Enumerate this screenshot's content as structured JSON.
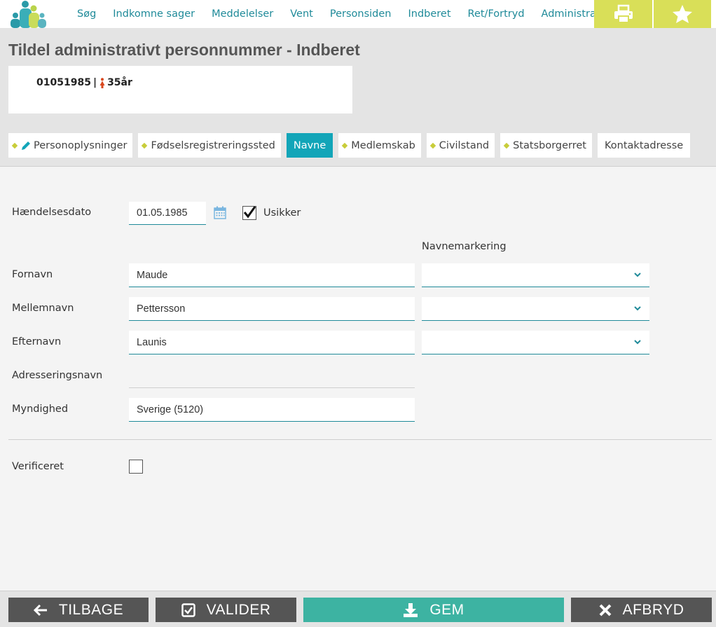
{
  "nav": {
    "items": [
      "Søg",
      "Indkomne sager",
      "Meddelelser",
      "Vent",
      "Personsiden",
      "Indberet",
      "Ret/Fortryd",
      "Administration"
    ],
    "print_icon": "printer-icon",
    "star_icon": "star-icon"
  },
  "colors": {
    "accent": "#1f8a99",
    "tab_active": "#12a5b8",
    "yellow": "#d9df58",
    "save": "#3db3a2",
    "dark_button": "#555555"
  },
  "page": {
    "title": "Tildel administrativt personnummer - Indberet"
  },
  "person": {
    "cpr": "01051985",
    "separator": "|",
    "age": "35år",
    "gender_icon": "female-icon"
  },
  "tabs": [
    {
      "label": "Personoplysninger",
      "active": false
    },
    {
      "label": "Fødselsregistreringssted",
      "active": false
    },
    {
      "label": "Navne",
      "active": true
    },
    {
      "label": "Medlemskab",
      "active": false
    },
    {
      "label": "Civilstand",
      "active": false
    },
    {
      "label": "Statsborgerret",
      "active": false
    },
    {
      "label": "Kontaktadresse",
      "active": false
    }
  ],
  "form": {
    "event_date_label": "Hændelsesdato",
    "event_date_value": "01.05.1985",
    "uncertain_label": "Usikker",
    "uncertain_checked": true,
    "name_marking_header": "Navnemarkering",
    "first_name_label": "Fornavn",
    "first_name_value": "Maude",
    "middle_name_label": "Mellemnavn",
    "middle_name_value": "Pettersson",
    "last_name_label": "Efternavn",
    "last_name_value": "Launis",
    "address_name_label": "Adresseringsnavn",
    "address_name_value": "",
    "authority_label": "Myndighed",
    "authority_value": "Sverige (5120)",
    "verified_label": "Verificeret",
    "verified_checked": false
  },
  "buttons": {
    "back": "TILBAGE",
    "validate": "VALIDER",
    "save": "GEM",
    "cancel": "AFBRYD"
  }
}
